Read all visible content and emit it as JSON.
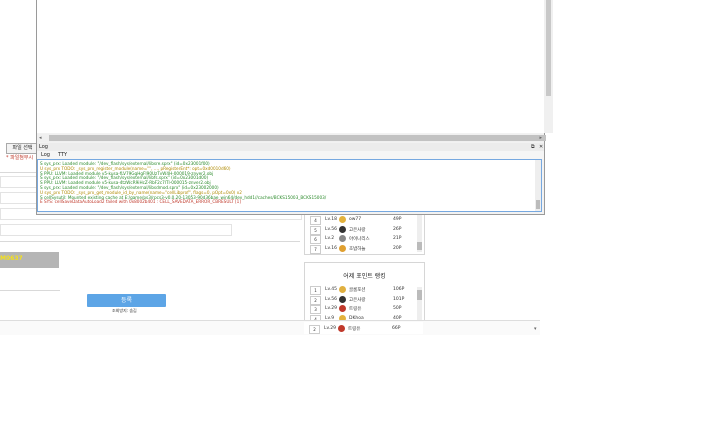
{
  "page": {
    "file_button": "파일 선택",
    "note_text": "* 파일첨부시",
    "yellow_text": "M0637",
    "register_button": "등록",
    "viewers_text": "조회방지: 숨김"
  },
  "rank_top": {
    "rows": [
      {
        "num": "4",
        "lv": "Lv.18",
        "name": "ow77",
        "pt": "49P",
        "color": "#e3b23c"
      },
      {
        "num": "5",
        "lv": "Lv.56",
        "name": "고은사랑",
        "pt": "26P",
        "color": "#333333"
      },
      {
        "num": "6",
        "lv": "Lv.2",
        "name": "아이나리스",
        "pt": "21P",
        "color": "#888888"
      },
      {
        "num": "7",
        "lv": "Lv.16",
        "name": "초밥하늘",
        "pt": "20P",
        "color": "#e0a030"
      }
    ]
  },
  "rank_yesterday": {
    "title": "어제 포인트 랭킹",
    "rows": [
      {
        "num": "1",
        "lv": "Lv.45",
        "name": "골롬포션",
        "pt": "106P",
        "color": "#e0b040"
      },
      {
        "num": "2",
        "lv": "Lv.56",
        "name": "고은사랑",
        "pt": "101P",
        "color": "#333333"
      },
      {
        "num": "3",
        "lv": "Lv.29",
        "name": "트링유",
        "pt": "50P",
        "color": "#c0392b"
      },
      {
        "num": "4",
        "lv": "Lv.9",
        "name": "DKhoa",
        "pt": "40P",
        "color": "#e3b23c"
      }
    ]
  },
  "rank_bottom": {
    "rows": [
      {
        "num": "2",
        "lv": "Lv.29",
        "name": "트링유",
        "pt": "66P",
        "color": "#c0392b"
      }
    ]
  },
  "emulator": {
    "log_title": "Log",
    "tabs": [
      "Log",
      "TTY"
    ],
    "log_lines": [
      {
        "text": "S sys_prx: Loaded module: \"/dev_flash/sys/external/libsre.sprx\" (id=0x23001f00)",
        "color": "#2a8a2a"
      },
      {
        "text": "U sys_prx TODO: _sys_prx_register_module(name=\"\", ..., pRegisterEnt*: opt=0xd0010d60)",
        "color": "#b08a00"
      },
      {
        "text": "S PPU: LLVM: Loaded module v5-kusa-fLV79GqHgFI90UzTvW4H-000019-znver2.obj",
        "color": "#2a8a2a"
      },
      {
        "text": "S sys_prx: Loaded module: \"/dev_flash/sys/external/libfs.sprx\" (id=0x23001d00)",
        "color": "#2a8a2a"
      },
      {
        "text": "S PPU: LLVM: Loaded module v5-kusa-4tzWcR9iHcZ-RbF2c7lTl-000015-znver2.obj",
        "color": "#2a8a2a"
      },
      {
        "text": "S sys_prx: Loaded module: \"/dev_flash/sys/external/libsdmod.sprx\" (id=0x23002000)",
        "color": "#2a8a2a"
      },
      {
        "text": "U sys_prx TODO: _sys_prx_get_module_id_by_name(name=\"cellLibprof\", flags=0, pOpt=0x0) x2",
        "color": "#b08a00"
      },
      {
        "text": "S cellSysutil: Mounted existing cache at E:/game/ps3/rpcs3-v0.0.20-13053-90d36bae_win64/dev_hdd1//caches/BCKS15003_BCKS15003/",
        "color": "#2a8a2a"
      },
      {
        "text": "E SYS: cellSaveDataAutoLoad2 failed with 0x8002b401 : CELL_SAVEDATA_ERROR_CBRESULT [1]",
        "color": "#c0392b"
      }
    ]
  }
}
